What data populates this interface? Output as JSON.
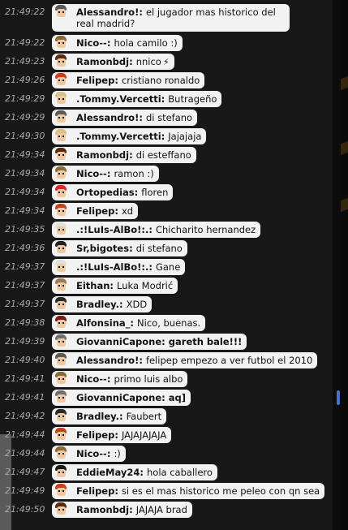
{
  "messages": [
    {
      "time": "21:49:22",
      "name": "Alessandro!:",
      "text": "el jugador mas historico del real madrid?",
      "avatar": {
        "skin": "#f1c9a0",
        "hair": "#5a5a5a"
      }
    },
    {
      "time": "21:49:22",
      "name": "Nico--:",
      "text": "hola camilo :)",
      "avatar": {
        "skin": "#f1c9a0",
        "hair": "#8a6a3a"
      }
    },
    {
      "time": "21:49:23",
      "name": "Ramonbdj:",
      "text": "nnico",
      "icon": "lightning-icon",
      "avatar": {
        "skin": "#f1c9a0",
        "hair": "#5a2b12"
      }
    },
    {
      "time": "21:49:26",
      "name": "Felipep:",
      "text": "cristiano ronaldo",
      "avatar": {
        "skin": "#f1c9a0",
        "hair": "#c8401e"
      }
    },
    {
      "time": "21:49:29",
      "name": ".Tommy.Vercetti:",
      "text": "Butrageño",
      "avatar": {
        "skin": "#f1c9a0",
        "hair": "#d8c28a"
      }
    },
    {
      "time": "21:49:29",
      "name": "Alessandro!:",
      "text": "di stefano",
      "avatar": {
        "skin": "#f1c9a0",
        "hair": "#5a5a5a"
      }
    },
    {
      "time": "21:49:30",
      "name": ".Tommy.Vercetti:",
      "text": "Jajajaja",
      "avatar": {
        "skin": "#f1c9a0",
        "hair": "#d8c28a"
      }
    },
    {
      "time": "21:49:34",
      "name": "Ramonbdj:",
      "text": "di esteffano",
      "avatar": {
        "skin": "#f1c9a0",
        "hair": "#5a2b12"
      }
    },
    {
      "time": "21:49:34",
      "name": "Nico--:",
      "text": "ramon :)",
      "avatar": {
        "skin": "#f1c9a0",
        "hair": "#8a6a3a"
      }
    },
    {
      "time": "21:49:34",
      "name": "Ortopedias:",
      "text": "floren",
      "avatar": {
        "skin": "#f1c9a0",
        "hair": "#d42a2a"
      }
    },
    {
      "time": "21:49:34",
      "name": "Felipep:",
      "text": "xd",
      "avatar": {
        "skin": "#f1c9a0",
        "hair": "#c8401e"
      }
    },
    {
      "time": "21:49:35",
      "name": ".:!LuIs-AlBo!:.:",
      "text": "Chicharito hernandez",
      "avatar": {
        "skin": "#f1c9a0",
        "hair": "#e0e0e0"
      }
    },
    {
      "time": "21:49:36",
      "name": "Sr,bigotes:",
      "text": "di stefano",
      "avatar": {
        "skin": "#f1c9a0",
        "hair": "#222222"
      }
    },
    {
      "time": "21:49:37",
      "name": ".:!LuIs-AlBo!:.:",
      "text": "Gane",
      "avatar": {
        "skin": "#f1c9a0",
        "hair": "#e0e0e0"
      }
    },
    {
      "time": "21:49:37",
      "name": "Eithan:",
      "text": "Luka Modrić",
      "avatar": {
        "skin": "#f1c9a0",
        "hair": "#9a7a5a"
      }
    },
    {
      "time": "21:49:37",
      "name": "Bradley.:",
      "text": "XDD",
      "avatar": {
        "skin": "#f1c9a0",
        "hair": "#2a2a2a"
      }
    },
    {
      "time": "21:49:38",
      "name": "Alfonsina_:",
      "text": "Nico, buenas.",
      "avatar": {
        "skin": "#f1c9a0",
        "hair": "#7a1a1a"
      }
    },
    {
      "time": "21:49:39",
      "name": "GiovanniCapone:",
      "text": "gareth bale!!!",
      "bold_text": true,
      "avatar": {
        "skin": "#f1c9a0",
        "hair": "#707070"
      }
    },
    {
      "time": "21:49:40",
      "name": "Alessandro!:",
      "text": "felipep empezo a ver futbol el 2010",
      "avatar": {
        "skin": "#f1c9a0",
        "hair": "#5a5a5a"
      }
    },
    {
      "time": "21:49:41",
      "name": "Nico--:",
      "text": "primo luis albo",
      "avatar": {
        "skin": "#f1c9a0",
        "hair": "#8a6a3a"
      }
    },
    {
      "time": "21:49:41",
      "name": "GiovanniCapone:",
      "text": "aq]",
      "bold_text": true,
      "avatar": {
        "skin": "#f1c9a0",
        "hair": "#707070"
      }
    },
    {
      "time": "21:49:42",
      "name": "Bradley.:",
      "text": "Faubert",
      "avatar": {
        "skin": "#f1c9a0",
        "hair": "#2a2a2a"
      }
    },
    {
      "time": "21:49:44",
      "name": "Felipep:",
      "text": "JAJAJAJAJA",
      "avatar": {
        "skin": "#f1c9a0",
        "hair": "#c8401e"
      }
    },
    {
      "time": "21:49:44",
      "name": "Nico--:",
      "text": ":)",
      "avatar": {
        "skin": "#f1c9a0",
        "hair": "#8a6a3a"
      }
    },
    {
      "time": "21:49:47",
      "name": "EddieMay24:",
      "text": "hola caballero",
      "avatar": {
        "skin": "#f1c9a0",
        "hair": "#1a1a1a"
      }
    },
    {
      "time": "21:49:49",
      "name": "Felipep:",
      "text": "si es el mas historico me peleo con qn sea",
      "avatar": {
        "skin": "#f1c9a0",
        "hair": "#c8401e"
      }
    },
    {
      "time": "21:49:50",
      "name": "Ramonbdj:",
      "text": "JAJAJA brad",
      "avatar": {
        "skin": "#f1c9a0",
        "hair": "#5a2b12"
      }
    }
  ]
}
